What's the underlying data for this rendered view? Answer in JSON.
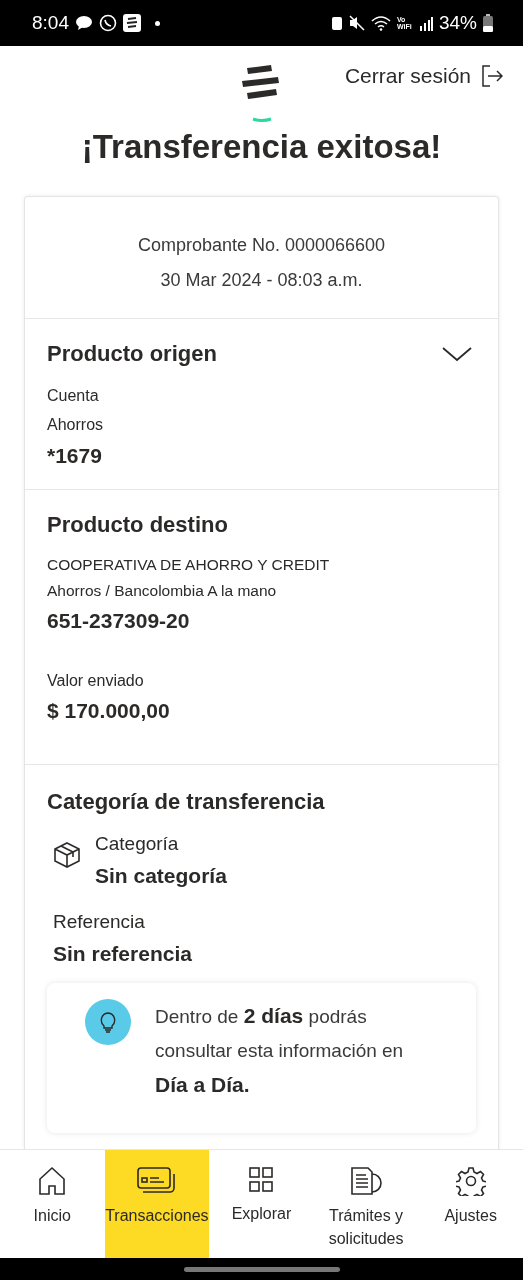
{
  "status_bar": {
    "time": "8:04",
    "network_label": "Vo WiFi",
    "battery_percent": "34%"
  },
  "header": {
    "logout": "Cerrar sesión"
  },
  "title": "¡Transferencia exitosa!",
  "receipt": {
    "number": "Comprobante No. 0000066600",
    "date": "30 Mar 2024 - 08:03 a.m."
  },
  "origin": {
    "title": "Producto origen",
    "expanded": false,
    "lines": [
      "Cuenta",
      "Ahorros"
    ],
    "account": "*1679"
  },
  "destination": {
    "title": "Producto destino",
    "lines": [
      "COOPERATIVA DE AHORRO Y CREDIT",
      "Ahorros / Bancolombia A la mano"
    ],
    "account": "651-237309-20",
    "amount_label": "Valor enviado",
    "amount": "$ 170.000,00"
  },
  "category": {
    "title": "Categoría de transferencia",
    "category_label": "Categoría",
    "category_value": "Sin categoría",
    "reference_label": "Referencia",
    "reference_value": "Sin referencia"
  },
  "tip": {
    "text": "Dentro de **2 días** podrás consultar esta información en **Día a Día.**"
  },
  "nav": [
    {
      "kind": "home",
      "label": "Inicio",
      "selected": false
    },
    {
      "kind": "cards",
      "label": "Transacciones",
      "selected": true
    },
    {
      "kind": "grid",
      "label": "Explorar",
      "selected": false
    },
    {
      "kind": "documents",
      "label": "Trámites y solicitudes",
      "selected": false
    },
    {
      "kind": "settings",
      "label": "Ajustes",
      "selected": false
    }
  ]
}
